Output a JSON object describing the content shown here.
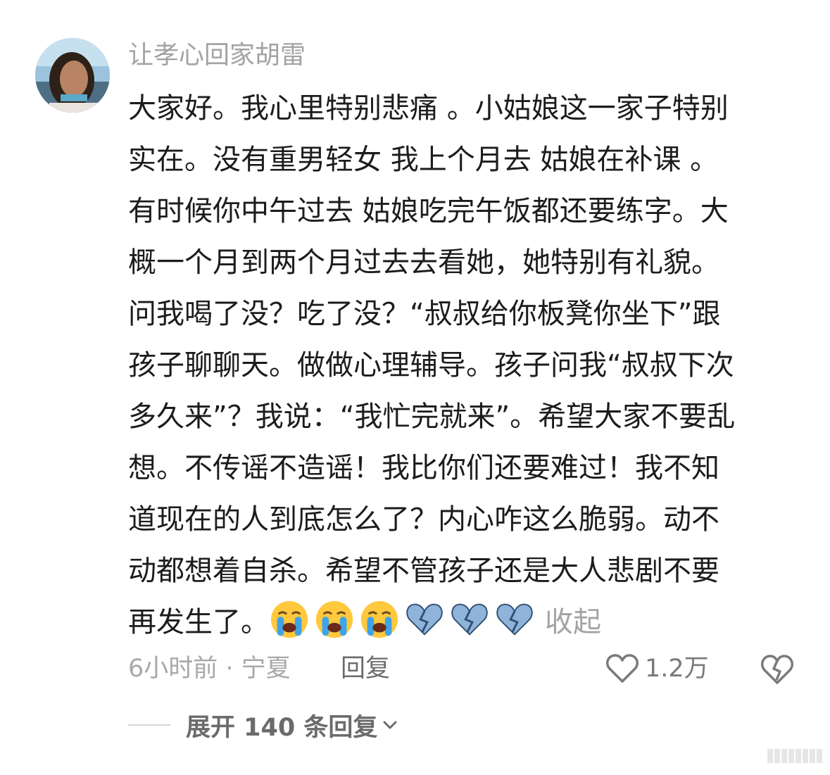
{
  "comment": {
    "username": "让孝心回家胡雷",
    "text_lines": [
      "大家好。我心里特别悲痛 。小姑娘这一家子特别",
      "实在。没有重男轻女 我上个月去 姑娘在补课 。",
      "有时候你中午过去 姑娘吃完午饭都还要练字。大",
      "概一个月到两个月过去去看她，她特别有礼貌。",
      "问我喝了没？吃了没？“叔叔给你板凳你坐下”跟",
      "孩子聊聊天。做做心理辅导。孩子问我“叔叔下次",
      "多久来”？我说：“我忙完就来”。希望大家不要乱",
      "想。不传谣不造谣！我比你们还要难过！我不知",
      "道现在的人到底怎么了？内心咋这么脆弱。动不",
      "动都想着自杀。希望不管孩子还是大人悲剧不要",
      "再发生了。"
    ],
    "emojis": [
      "loudly-crying-face",
      "loudly-crying-face",
      "loudly-crying-face",
      "broken-blue-heart",
      "broken-blue-heart",
      "broken-blue-heart"
    ],
    "collapse_label": "收起",
    "meta": {
      "time_location": "6小时前 · 宁夏",
      "reply_label": "回复",
      "like_count": "1.2万"
    },
    "expand_replies_label": "展开 140 条回复"
  },
  "colors": {
    "secondary_text": "#a3a3a3",
    "body_text": "#1c1c1c",
    "action_text": "#6b6b6b",
    "broken_heart": "#8fb3d9"
  }
}
